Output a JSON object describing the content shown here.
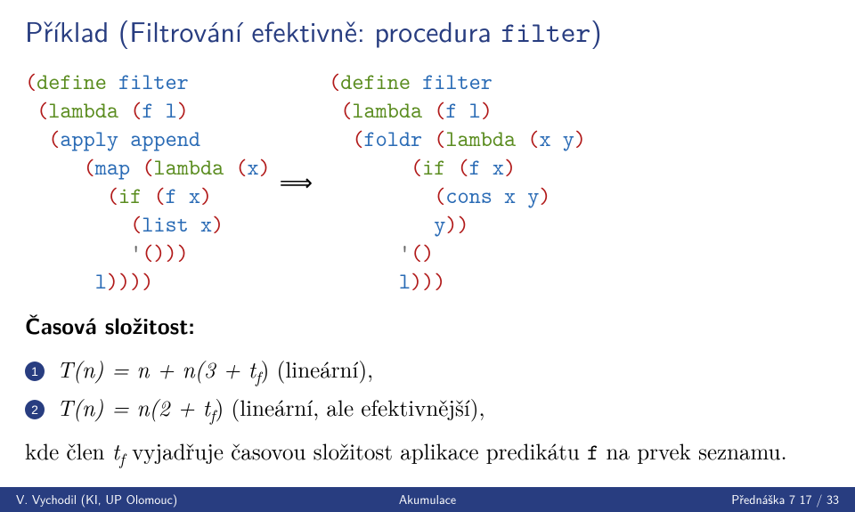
{
  "title_prefix": "Příklad (Filtrování efektivně: procedura ",
  "title_code": "filter",
  "title_suffix": ")",
  "code_left": [
    {
      "indent": 0,
      "tokens": [
        [
          "paren",
          "("
        ],
        [
          "kw",
          "define"
        ],
        [
          "plain",
          " "
        ],
        [
          "var",
          "filter"
        ]
      ]
    },
    {
      "indent": 1,
      "tokens": [
        [
          "paren",
          "("
        ],
        [
          "kw",
          "lambda"
        ],
        [
          "plain",
          " "
        ],
        [
          "paren",
          "("
        ],
        [
          "var",
          "f"
        ],
        [
          "plain",
          " "
        ],
        [
          "var",
          "l"
        ],
        [
          "paren",
          ")"
        ]
      ]
    },
    {
      "indent": 2,
      "tokens": [
        [
          "paren",
          "("
        ],
        [
          "var",
          "apply"
        ],
        [
          "plain",
          " "
        ],
        [
          "var",
          "append"
        ]
      ]
    },
    {
      "indent": 5,
      "tokens": [
        [
          "paren",
          "("
        ],
        [
          "var",
          "map"
        ],
        [
          "plain",
          " "
        ],
        [
          "paren",
          "("
        ],
        [
          "kw",
          "lambda"
        ],
        [
          "plain",
          " "
        ],
        [
          "paren",
          "("
        ],
        [
          "var",
          "x"
        ],
        [
          "paren",
          ")"
        ]
      ]
    },
    {
      "indent": 7,
      "tokens": [
        [
          "paren",
          "("
        ],
        [
          "kw",
          "if"
        ],
        [
          "plain",
          " "
        ],
        [
          "paren",
          "("
        ],
        [
          "var",
          "f"
        ],
        [
          "plain",
          " "
        ],
        [
          "var",
          "x"
        ],
        [
          "paren",
          ")"
        ]
      ]
    },
    {
      "indent": 9,
      "tokens": [
        [
          "paren",
          "("
        ],
        [
          "var",
          "list"
        ],
        [
          "plain",
          " "
        ],
        [
          "var",
          "x"
        ],
        [
          "paren",
          ")"
        ]
      ]
    },
    {
      "indent": 9,
      "tokens": [
        [
          "quote",
          "'"
        ],
        [
          "paren",
          "()))"
        ]
      ]
    },
    {
      "indent": 6,
      "tokens": [
        [
          "var",
          "l"
        ],
        [
          "paren",
          "))))"
        ]
      ]
    }
  ],
  "arrow": "⟹",
  "code_right": [
    {
      "indent": 0,
      "tokens": [
        [
          "paren",
          "("
        ],
        [
          "kw",
          "define"
        ],
        [
          "plain",
          " "
        ],
        [
          "var",
          "filter"
        ]
      ]
    },
    {
      "indent": 1,
      "tokens": [
        [
          "paren",
          "("
        ],
        [
          "kw",
          "lambda"
        ],
        [
          "plain",
          " "
        ],
        [
          "paren",
          "("
        ],
        [
          "var",
          "f"
        ],
        [
          "plain",
          " "
        ],
        [
          "var",
          "l"
        ],
        [
          "paren",
          ")"
        ]
      ]
    },
    {
      "indent": 2,
      "tokens": [
        [
          "paren",
          "("
        ],
        [
          "var",
          "foldr"
        ],
        [
          "plain",
          " "
        ],
        [
          "paren",
          "("
        ],
        [
          "kw",
          "lambda"
        ],
        [
          "plain",
          " "
        ],
        [
          "paren",
          "("
        ],
        [
          "var",
          "x"
        ],
        [
          "plain",
          " "
        ],
        [
          "var",
          "y"
        ],
        [
          "paren",
          ")"
        ]
      ]
    },
    {
      "indent": 7,
      "tokens": [
        [
          "paren",
          "("
        ],
        [
          "kw",
          "if"
        ],
        [
          "plain",
          " "
        ],
        [
          "paren",
          "("
        ],
        [
          "var",
          "f"
        ],
        [
          "plain",
          " "
        ],
        [
          "var",
          "x"
        ],
        [
          "paren",
          ")"
        ]
      ]
    },
    {
      "indent": 9,
      "tokens": [
        [
          "paren",
          "("
        ],
        [
          "var",
          "cons"
        ],
        [
          "plain",
          " "
        ],
        [
          "var",
          "x"
        ],
        [
          "plain",
          " "
        ],
        [
          "var",
          "y"
        ],
        [
          "paren",
          ")"
        ]
      ]
    },
    {
      "indent": 9,
      "tokens": [
        [
          "var",
          "y"
        ],
        [
          "paren",
          "))"
        ]
      ]
    },
    {
      "indent": 6,
      "tokens": [
        [
          "quote",
          "'"
        ],
        [
          "paren",
          "()"
        ]
      ]
    },
    {
      "indent": 6,
      "tokens": [
        [
          "var",
          "l"
        ],
        [
          "paren",
          ")))"
        ]
      ]
    }
  ],
  "subhead": "Časová složitost:",
  "items": [
    {
      "num": "1",
      "math": "T(n) = n + n(3 + t",
      "sub": "f",
      "after": ") (lineární),"
    },
    {
      "num": "2",
      "math": "T(n) = n(2 + t",
      "sub": "f",
      "after": ") (lineární, ale efektivnější),"
    }
  ],
  "footnote_pre": "kde člen ",
  "footnote_math": "t",
  "footnote_sub": "f",
  "footnote_post_a": " vyjadřuje časovou složitost aplikace predikátu ",
  "footnote_code": "f",
  "footnote_post_b": " na prvek seznamu.",
  "footer": {
    "left": "V. Vychodil (KI, UP Olomouc)",
    "mid": "Akumulace",
    "right": "Přednáška 7     17 / 33"
  }
}
